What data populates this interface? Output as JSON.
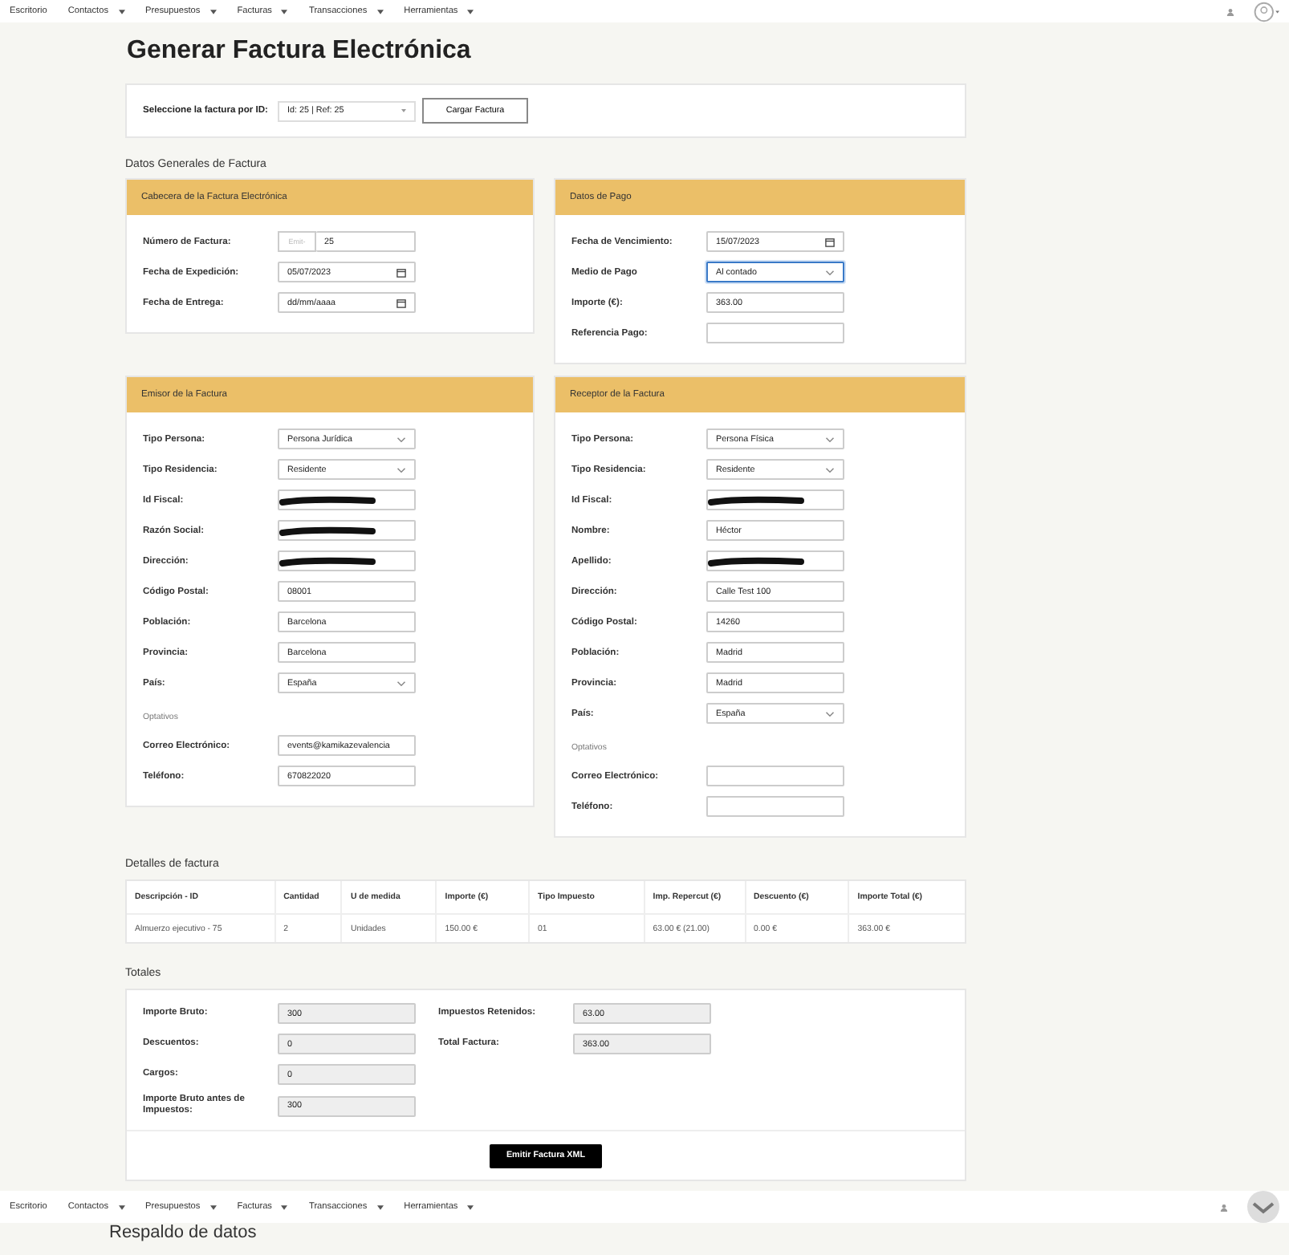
{
  "top_nav": {
    "items": [
      {
        "label": "Escritorio",
        "dropdown": false
      },
      {
        "label": "Contactos",
        "dropdown": true
      },
      {
        "label": "Presupuestos",
        "dropdown": true
      },
      {
        "label": "Facturas",
        "dropdown": true
      },
      {
        "label": "Transacciones",
        "dropdown": true
      },
      {
        "label": "Herramientas",
        "dropdown": true
      }
    ]
  },
  "page_title": "Generar Factura Electrónica",
  "invoice_selector": {
    "label": "Seleccione la factura por ID:",
    "value": "Id: 25 | Ref: 25",
    "button": "Cargar Factura"
  },
  "general_heading": "Datos Generales de Factura",
  "cards": [
    {
      "title": "Cabecera de la Factura Electrónica",
      "fields": [
        {
          "label": "Número de Factura:",
          "kind": "prefixed",
          "prefix": "Emit-",
          "value": "25"
        },
        {
          "label": "Fecha de Expedición:",
          "kind": "date",
          "value": "05/07/2023"
        },
        {
          "label": "Fecha de Entrega:",
          "kind": "date",
          "value": "dd/mm/aaaa"
        }
      ]
    },
    {
      "title": "Datos de Pago",
      "fields": [
        {
          "label": "Fecha de Vencimiento:",
          "kind": "date",
          "value": "15/07/2023"
        },
        {
          "label": "Medio de Pago",
          "kind": "select",
          "value": "Al contado",
          "focused": true
        },
        {
          "label": "Importe (€):",
          "kind": "text",
          "value": "363.00"
        },
        {
          "label": "Referencia Pago:",
          "kind": "text"
        }
      ]
    },
    {
      "title": "Emisor de la Factura",
      "fields": [
        {
          "label": "Tipo Persona:",
          "kind": "select",
          "value": "Persona Jurídica",
          "focused": false
        },
        {
          "label": "Tipo Residencia:",
          "kind": "select",
          "value": "Residente",
          "focused": false
        },
        {
          "label": "Id Fiscal:",
          "kind": "redacted"
        },
        {
          "label": "Razón Social:",
          "kind": "redacted"
        },
        {
          "label": "Dirección:",
          "kind": "redacted"
        },
        {
          "label": "Código Postal:",
          "kind": "text",
          "value": "08001"
        },
        {
          "label": "Población:",
          "kind": "text",
          "value": "Barcelona"
        },
        {
          "label": "Provincia:",
          "kind": "text",
          "value": "Barcelona"
        },
        {
          "label": "País:",
          "kind": "select",
          "value": "España",
          "focused": false
        }
      ],
      "optional_label": "Optativos",
      "optional_fields": [
        {
          "label": "Correo Electrónico:",
          "kind": "text",
          "value": "events@kamikazevalencia"
        },
        {
          "label": "Teléfono:",
          "kind": "text",
          "value": "670822020"
        }
      ]
    },
    {
      "title": "Receptor de la Factura",
      "fields": [
        {
          "label": "Tipo Persona:",
          "kind": "select",
          "value": "Persona Física",
          "focused": false
        },
        {
          "label": "Tipo Residencia:",
          "kind": "select",
          "value": "Residente",
          "focused": false
        },
        {
          "label": "Id Fiscal:",
          "kind": "redacted"
        },
        {
          "label": "Nombre:",
          "kind": "text",
          "value": "Héctor"
        },
        {
          "label": "Apellido:",
          "kind": "redacted"
        },
        {
          "label": "Dirección:",
          "kind": "text",
          "value": "Calle Test 100"
        },
        {
          "label": "Código Postal:",
          "kind": "text",
          "value": "14260"
        },
        {
          "label": "Población:",
          "kind": "text",
          "value": "Madrid"
        },
        {
          "label": "Provincia:",
          "kind": "text",
          "value": "Madrid"
        },
        {
          "label": "País:",
          "kind": "select",
          "value": "España",
          "focused": false
        }
      ],
      "optional_label": "Optativos",
      "optional_fields": [
        {
          "label": "Correo Electrónico:",
          "kind": "text"
        },
        {
          "label": "Teléfono:",
          "kind": "text"
        }
      ]
    }
  ],
  "details": {
    "heading": "Detalles de factura",
    "columns": [
      "Descripción - ID",
      "Cantidad",
      "U de medida",
      "Importe (€)",
      "Tipo Impuesto",
      "Imp. Repercut (€)",
      "Descuento (€)",
      "Importe Total (€)"
    ],
    "rows": [
      [
        "Almuerzo ejecutivo - 75",
        "2",
        "Unidades",
        "150.00 €",
        "01",
        "63.00 € (21.00)",
        "0.00 €",
        "363.00 €"
      ]
    ]
  },
  "totals": {
    "heading": "Totales",
    "left": [
      {
        "label": "Importe Bruto:",
        "value": "300"
      },
      {
        "label": "Descuentos:",
        "value": "0"
      },
      {
        "label": "Cargos:",
        "value": "0"
      },
      {
        "label": "Importe Bruto antes de Impuestos:",
        "value": "300"
      }
    ],
    "right": [
      {
        "label": "Impuestos Retenidos:",
        "value": "63.00"
      },
      {
        "label": "Total Factura:",
        "value": "363.00"
      }
    ],
    "button": "Emitir Factura XML"
  },
  "bottom_nav": {
    "items": [
      {
        "label": "Escritorio",
        "dropdown": false
      },
      {
        "label": "Contactos",
        "dropdown": true
      },
      {
        "label": "Presupuestos",
        "dropdown": true
      },
      {
        "label": "Facturas",
        "dropdown": true
      },
      {
        "label": "Transacciones",
        "dropdown": true
      },
      {
        "label": "Herramientas",
        "dropdown": true
      }
    ]
  },
  "next_page_title": "Respaldo de datos"
}
